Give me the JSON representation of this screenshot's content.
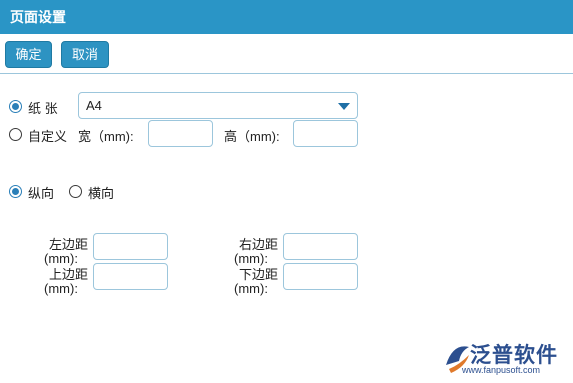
{
  "window": {
    "title": "页面设置"
  },
  "toolbar": {
    "confirm_label": "确定",
    "cancel_label": "取消"
  },
  "paper": {
    "paper_option_label": "纸 张",
    "paper_selected": "A4",
    "custom_option_label": "自定义",
    "width_label": "宽（mm):",
    "height_label": "高（mm):",
    "width_value": "",
    "height_value": ""
  },
  "orientation": {
    "portrait_label": "纵向",
    "landscape_label": "横向",
    "selected": "portrait"
  },
  "margins": {
    "left_label_1": "左边距",
    "left_label_2": "(mm):",
    "right_label_1": "右边距",
    "right_label_2": "(mm):",
    "top_label_1": "上边距",
    "top_label_2": "(mm):",
    "bottom_label_1": "下边距",
    "bottom_label_2": "(mm):",
    "left_value": "",
    "right_value": "",
    "top_value": "",
    "bottom_value": ""
  },
  "watermark": {
    "brand": "泛普软件",
    "url": "www.fanpusoft.com"
  },
  "colors": {
    "titlebar": "#2a95c6",
    "button": "#2d93c2",
    "border": "#9cc6dc",
    "radio_checked": "#2a7fb8",
    "logo": "#2c4f8f"
  }
}
